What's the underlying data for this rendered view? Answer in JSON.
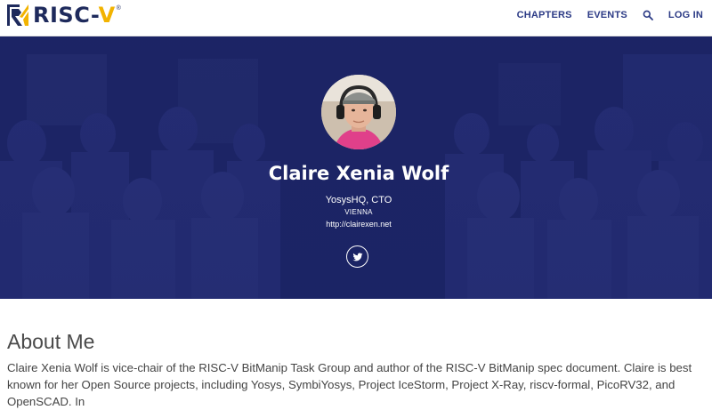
{
  "nav": {
    "logo_text": "RISC-",
    "logo_accent": "V",
    "logo_reg": "®",
    "links": [
      "CHAPTERS",
      "EVENTS"
    ],
    "login_label": "LOG IN"
  },
  "profile": {
    "name": "Claire Xenia Wolf",
    "title": "YosysHQ, CTO",
    "location": "VIENNA",
    "url": "http://clairexen.net"
  },
  "about": {
    "heading": "About Me",
    "text": "Claire Xenia Wolf is vice-chair of the RISC-V BitManip Task Group and author of the RISC-V BitManip spec document. Claire is best known for her Open Source projects, including Yosys, SymbiYosys, Project IceStorm, Project X-Ray, riscv-formal, PicoRV32, and OpenSCAD. In"
  },
  "colors": {
    "brand_blue": "#1e2a5c",
    "brand_gold": "#f2b300",
    "nav_link": "#2b3a85",
    "hero_bg": "#1c2466"
  },
  "icons": [
    "risc-v-logo-icon",
    "search-icon",
    "twitter-icon"
  ]
}
